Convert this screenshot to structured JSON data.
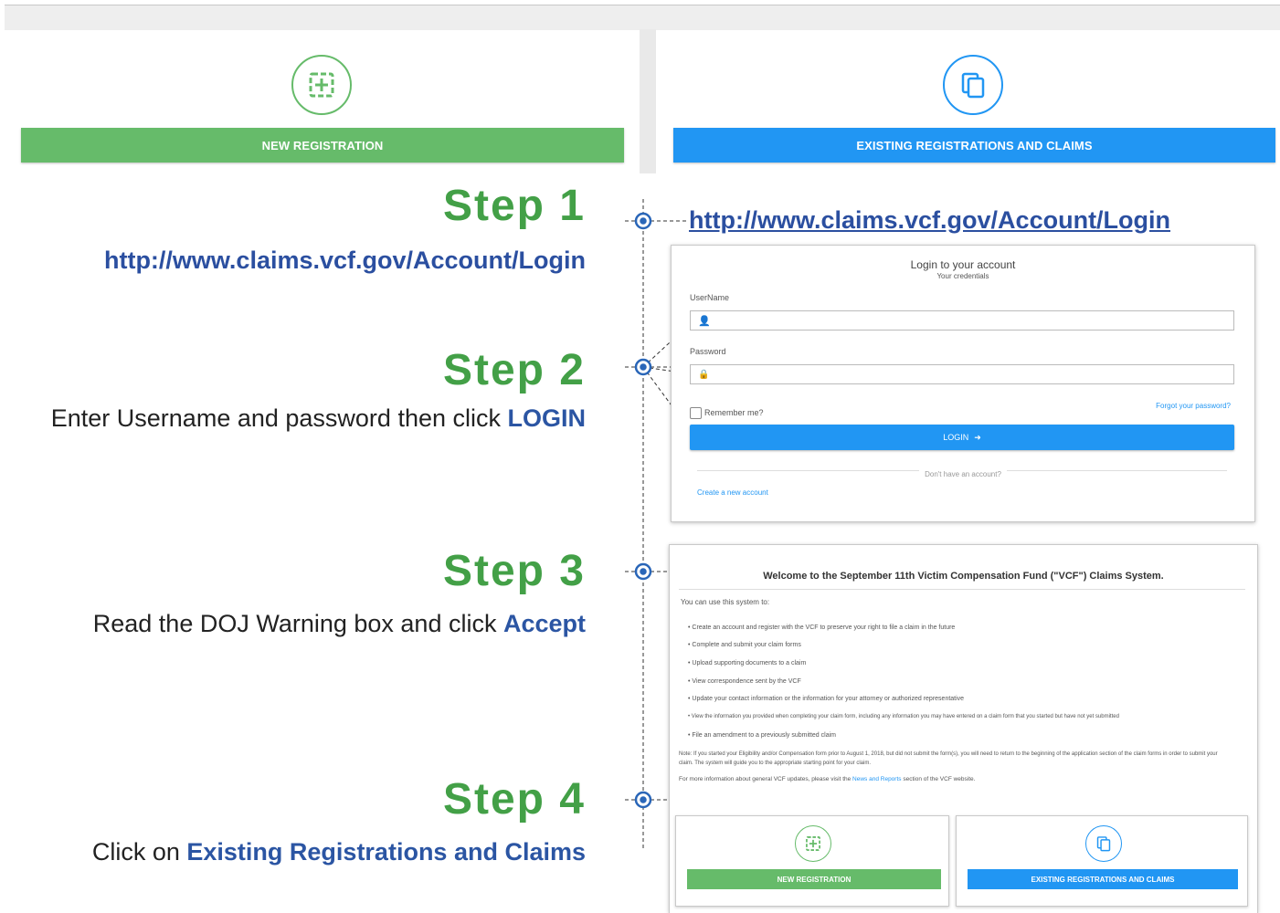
{
  "header": {
    "new_registration_label": "NEW REGISTRATION",
    "existing_label": "EXISTING REGISTRATIONS AND CLAIMS",
    "new_icon": "add-box-icon",
    "existing_icon": "copy-documents-icon"
  },
  "steps": [
    {
      "title": "Step 1",
      "text": "http://www.claims.vcf.gov/Account/Login"
    },
    {
      "title": "Step 2",
      "text_prefix": "Enter Username and password then click ",
      "text_highlight": "LOGIN"
    },
    {
      "title": "Step 3",
      "text_prefix": "Read the DOJ Warning box and click ",
      "text_highlight": "Accept"
    },
    {
      "title": "Step 4",
      "text_prefix": "Click on ",
      "text_highlight": "Existing Registrations and Claims"
    }
  ],
  "login_url": "http://www.claims.vcf.gov/Account/Login",
  "login_card": {
    "title": "Login to your account",
    "subtitle": "Your credentials",
    "username_label": "UserName",
    "password_label": "Password",
    "remember_label": "Remember me?",
    "forgot_link": "Forgot your password?",
    "login_button": "LOGIN",
    "no_account": "Don't have an account?",
    "create_link": "Create a new account"
  },
  "welcome_card": {
    "title": "Welcome to the September 11th Victim Compensation Fund (\"VCF\") Claims System.",
    "intro": "You can use this system to:",
    "bullets": [
      "Create an account and register with the VCF to preserve your right to file a claim in the future",
      "Complete and submit your claim forms",
      "Upload supporting documents to a claim",
      "View correspondence sent by the VCF",
      "Update your contact information or the information for your attorney or authorized representative",
      "View the information you provided when completing your claim form, including any information you may have entered on a claim form that you started but have not yet submitted",
      "File an amendment to a previously submitted claim"
    ],
    "note": "Note: If you started your Eligibility and/or Compensation form prior to August 1, 2018, but did not submit the form(s), you will need to return to the beginning of the application section of the claim forms in order to submit your claim. The system will guide you to the appropriate starting point for your claim.",
    "more_prefix": "For more information about general VCF updates, please visit the ",
    "more_link": "News and Reports",
    "more_suffix": " section of the VCF website.",
    "new_registration_label": "NEW REGISTRATION",
    "existing_label": "EXISTING REGISTRATIONS AND CLAIMS"
  },
  "colors": {
    "green": "#66bb6a",
    "blue": "#2196f3",
    "step_green": "#43a047",
    "link_blue": "#2b4fa0"
  }
}
